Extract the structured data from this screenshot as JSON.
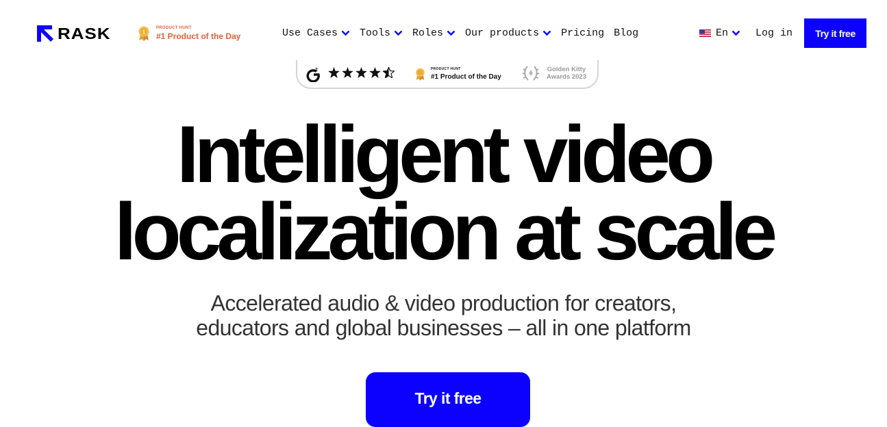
{
  "brand": {
    "logo_text": "RASK",
    "logo_icon": "arrow-logo-icon"
  },
  "product_hunt_badge": {
    "small": "PRODUCT HUNT",
    "big": "#1 Product of the Day",
    "color": "#e0603a"
  },
  "nav": {
    "menu": [
      {
        "label": "Use Cases",
        "has_dropdown": true
      },
      {
        "label": "Tools",
        "has_dropdown": true
      },
      {
        "label": "Roles",
        "has_dropdown": true
      },
      {
        "label": "Our products",
        "has_dropdown": true
      },
      {
        "label": "Pricing",
        "has_dropdown": false
      },
      {
        "label": "Blog",
        "has_dropdown": false
      }
    ],
    "language": "En",
    "language_flag": "us-flag-icon",
    "login": "Log in",
    "cta": "Try it free"
  },
  "ratings_bar": {
    "g2_stars": 4.5,
    "product_hunt": {
      "small": "PRODUCT HUNT",
      "big": "#1 Product of the Day"
    },
    "golden_kitty": {
      "line1": "Golden Kitty",
      "line2": "Awards 2023"
    }
  },
  "hero": {
    "headline_line1": "Intelligent video",
    "headline_line2": "localization at scale",
    "subtitle_line1": "Accelerated audio & video production for creators,",
    "subtitle_line2": "educators and global businesses – all in one platform",
    "cta": "Try it free"
  },
  "colors": {
    "accent": "#0c00ff",
    "text": "#000000",
    "subtitle": "#333333"
  }
}
